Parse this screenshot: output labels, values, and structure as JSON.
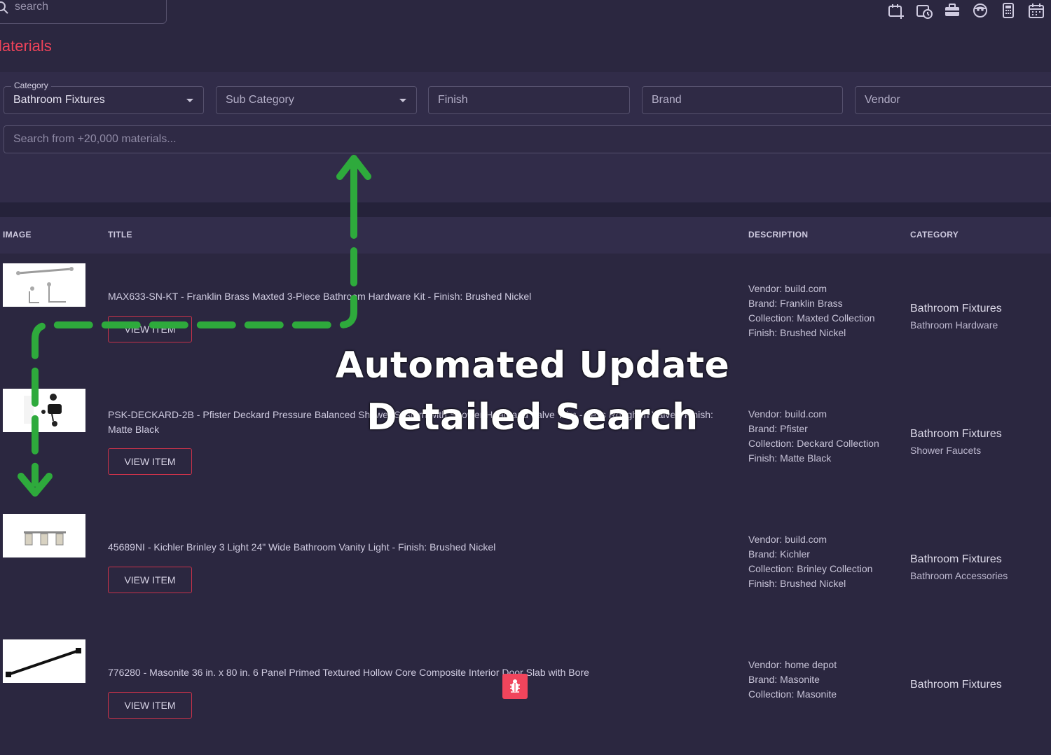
{
  "header": {
    "search_placeholder": "search",
    "icons": [
      "calendar-plus-icon",
      "calendar-clock-icon",
      "briefcase-icon",
      "face-icon",
      "calculator-icon",
      "calendar-icon"
    ],
    "page_title": "laterials"
  },
  "filters": {
    "category_label": "Category",
    "category_value": "Bathroom Fixtures",
    "subcategory_placeholder": "Sub Category",
    "finish_placeholder": "Finish",
    "brand_placeholder": "Brand",
    "vendor_placeholder": "Vendor",
    "search_placeholder": "Search from +20,000 materials..."
  },
  "table": {
    "headers": [
      "IMAGE",
      "TITLE",
      "DESCRIPTION",
      "CATEGORY"
    ],
    "view_label": "VIEW ITEM",
    "rows": [
      {
        "title": "MAX633-SN-KT - Franklin Brass Maxted 3-Piece Bathroom Hardware Kit - Finish: Brushed Nickel",
        "desc": [
          "Vendor: build.com",
          "Brand: Franklin Brass",
          "Collection: Maxted Collection",
          "Finish: Brushed Nickel"
        ],
        "category": "Bathroom Fixtures",
        "subcategory": "Bathroom Hardware"
      },
      {
        "title": "PSK-DECKARD-2B - Pfister Deckard Pressure Balanced Shower System with Shower Head and Valve Trim - Less Rough-In Valve - Finish: Matte Black",
        "desc": [
          "Vendor: build.com",
          "Brand: Pfister",
          "Collection: Deckard Collection",
          "Finish: Matte Black"
        ],
        "category": "Bathroom Fixtures",
        "subcategory": "Shower Faucets"
      },
      {
        "title": "45689NI - Kichler Brinley 3 Light 24\" Wide Bathroom Vanity Light - Finish: Brushed Nickel",
        "desc": [
          "Vendor: build.com",
          "Brand: Kichler",
          "Collection: Brinley Collection",
          "Finish: Brushed Nickel"
        ],
        "category": "Bathroom Fixtures",
        "subcategory": "Bathroom Accessories"
      },
      {
        "title": "776280 - Masonite 36 in. x 80 in. 6 Panel Primed Textured Hollow Core Composite Interior Door Slab with Bore",
        "desc": [
          "Vendor: home depot",
          "Brand: Masonite",
          "Collection: Masonite"
        ],
        "category": "Bathroom Fixtures",
        "subcategory": ""
      }
    ]
  },
  "overlay": {
    "line1": "Automated Update",
    "line2": "Detailed Search",
    "arrow_color": "#2eaa3c"
  },
  "colors": {
    "accent": "#f0435a",
    "background": "#2b2740"
  }
}
